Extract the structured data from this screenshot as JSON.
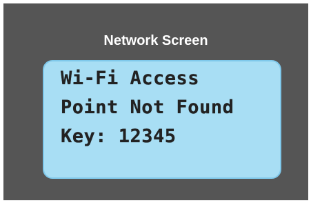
{
  "screen": {
    "title": "Network Screen",
    "lines": [
      "Wi-Fi Access",
      "Point Not Found",
      "Key: 12345"
    ]
  },
  "colors": {
    "frame": "#555555",
    "lcd_background": "#a8def4",
    "lcd_border": "#7fc8ea",
    "lcd_text": "#222222",
    "title_text": "#ffffff"
  }
}
